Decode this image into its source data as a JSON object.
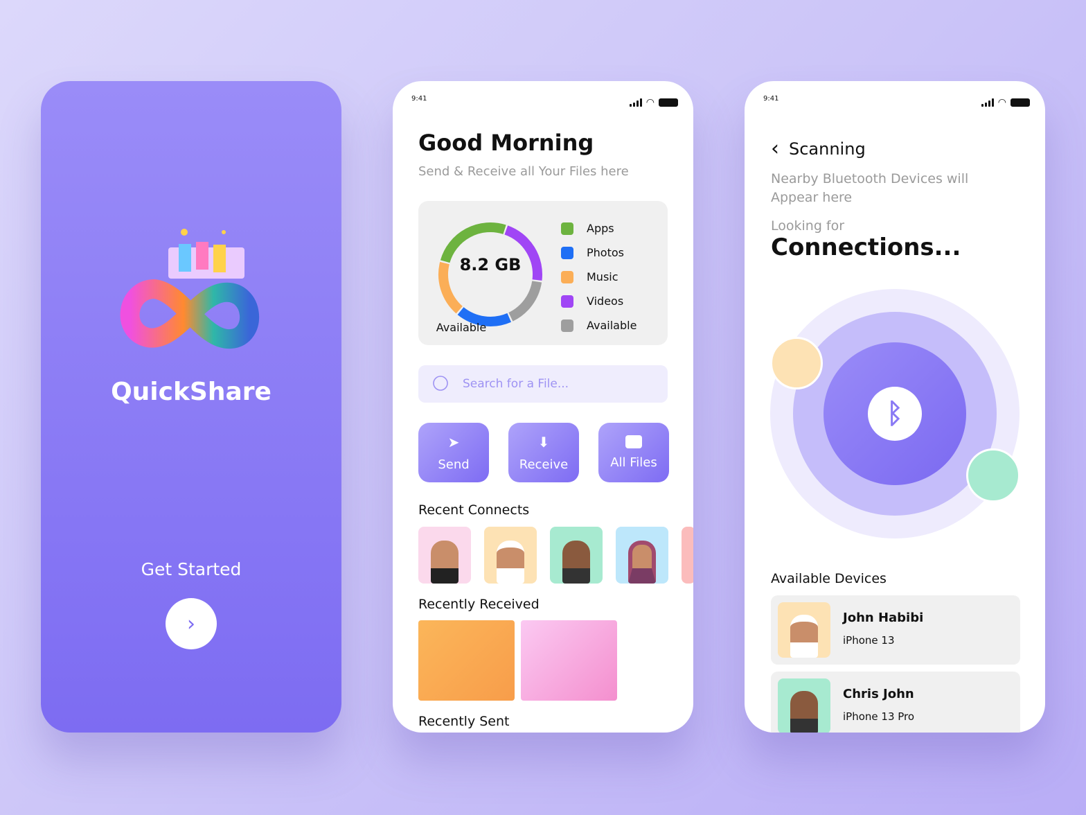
{
  "splash": {
    "brand": "QuickShare",
    "cta": "Get Started",
    "next_icon": "chevron-right-icon"
  },
  "home": {
    "time": "9:41",
    "title": "Good Morning",
    "subtitle": "Send & Receive all Your Files here",
    "storage": {
      "value": "8.2 GB",
      "label": "Available"
    },
    "chart_data": {
      "type": "pie",
      "segments": [
        {
          "name": "Apps",
          "color": "#6db33f",
          "percent": 26
        },
        {
          "name": "Videos",
          "color": "#a046f5",
          "percent": 22
        },
        {
          "name": "Available",
          "color": "#9e9e9e",
          "percent": 16
        },
        {
          "name": "Photos",
          "color": "#1f6ff5",
          "percent": 18
        },
        {
          "name": "Music",
          "color": "#fbae57",
          "percent": 18
        }
      ],
      "legend": [
        {
          "name": "Apps",
          "color": "#6db33f"
        },
        {
          "name": "Photos",
          "color": "#1f6ff5"
        },
        {
          "name": "Music",
          "color": "#fbae57"
        },
        {
          "name": "Videos",
          "color": "#a046f5"
        },
        {
          "name": "Available",
          "color": "#9e9e9e"
        }
      ]
    },
    "search_placeholder": "Search for a File...",
    "actions": [
      {
        "label": "Send",
        "icon": "send-icon"
      },
      {
        "label": "Receive",
        "icon": "inbox-download-icon"
      },
      {
        "label": "All Files",
        "icon": "folder-icon"
      }
    ],
    "recent_connects": "Recent Connects",
    "recently_received": "Recently Received",
    "recently_sent": "Recently Sent"
  },
  "scan": {
    "time": "9:41",
    "title": "Scanning",
    "subtitle": "Nearby Bluetooth Devices will Appear here",
    "looking": "Looking for",
    "connections": "Connections...",
    "available_devices": "Available Devices",
    "devices": [
      {
        "name": "John Habibi",
        "model": "iPhone 13"
      },
      {
        "name": "Chris John",
        "model": "iPhone 13 Pro"
      }
    ]
  },
  "colors": {
    "accent": "#7d6cf2"
  }
}
